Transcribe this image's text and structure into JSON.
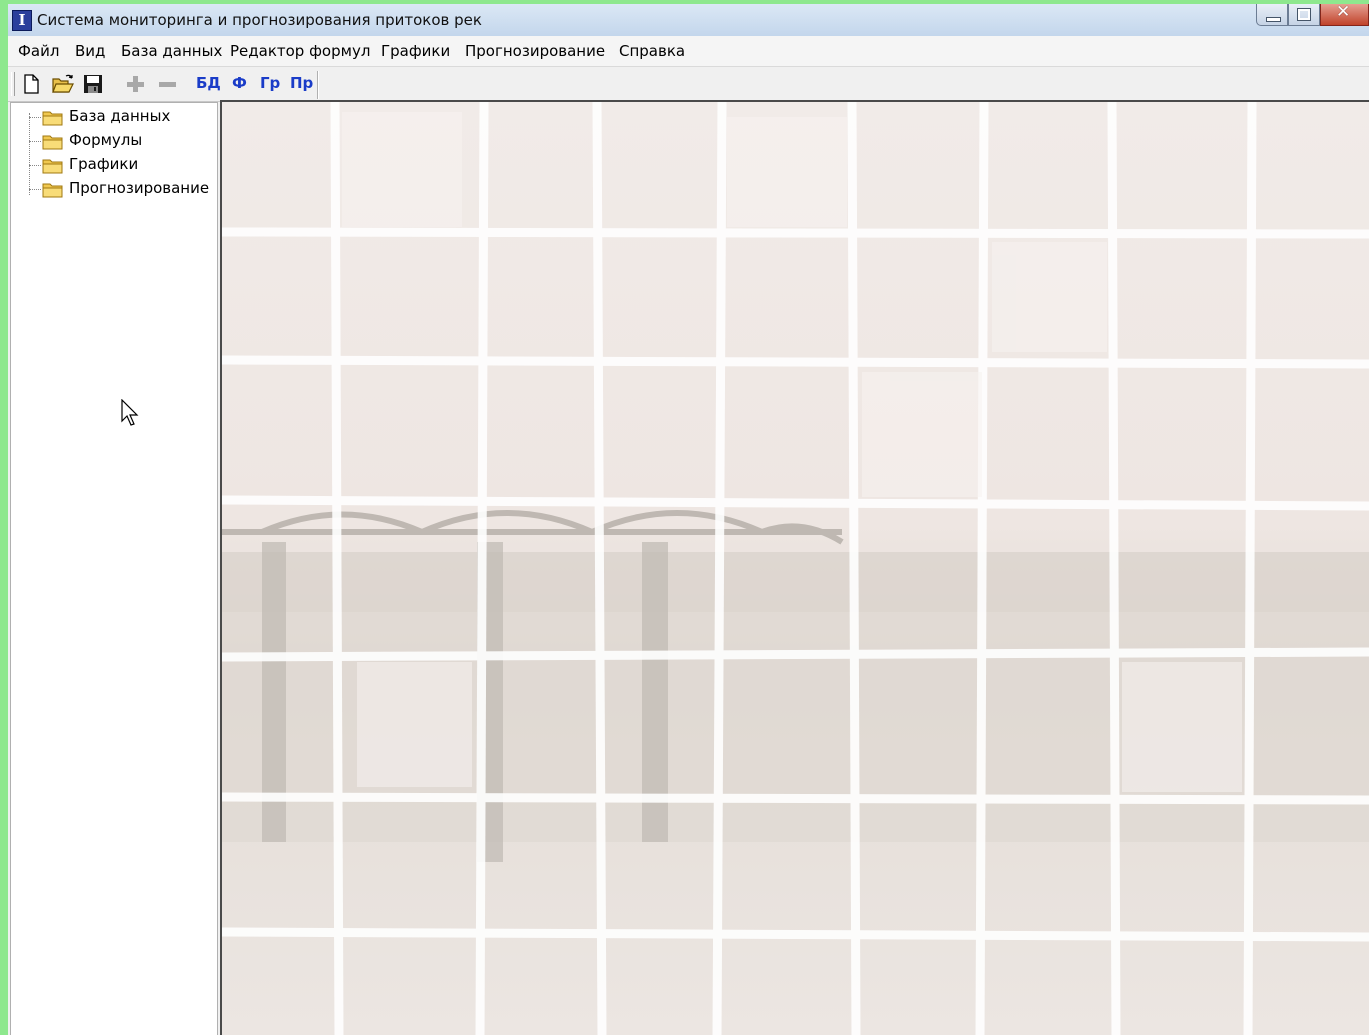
{
  "window": {
    "title": "Система мониторинга и прогнозирования притоков рек"
  },
  "menu": [
    {
      "label": "Файл"
    },
    {
      "label": "Вид"
    },
    {
      "label": "База данных"
    },
    {
      "label": "Редактор формул"
    },
    {
      "label": "Графики"
    },
    {
      "label": "Прогнозирование"
    },
    {
      "label": "Справка"
    }
  ],
  "toolbar": {
    "icons": [
      "new-document-icon",
      "open-folder-icon",
      "save-disk-icon",
      "add-plus-icon",
      "remove-minus-icon"
    ],
    "buttons": [
      {
        "label": "БД"
      },
      {
        "label": "Ф"
      },
      {
        "label": "Гр"
      },
      {
        "label": "Пр"
      }
    ],
    "text_color": "#1a3cc8"
  },
  "tree": [
    {
      "label": "База данных"
    },
    {
      "label": "Формулы"
    },
    {
      "label": "Графики"
    },
    {
      "label": "Прогнозирование"
    }
  ],
  "workspace": {
    "background": "faded-river-bridge-mosaic"
  }
}
